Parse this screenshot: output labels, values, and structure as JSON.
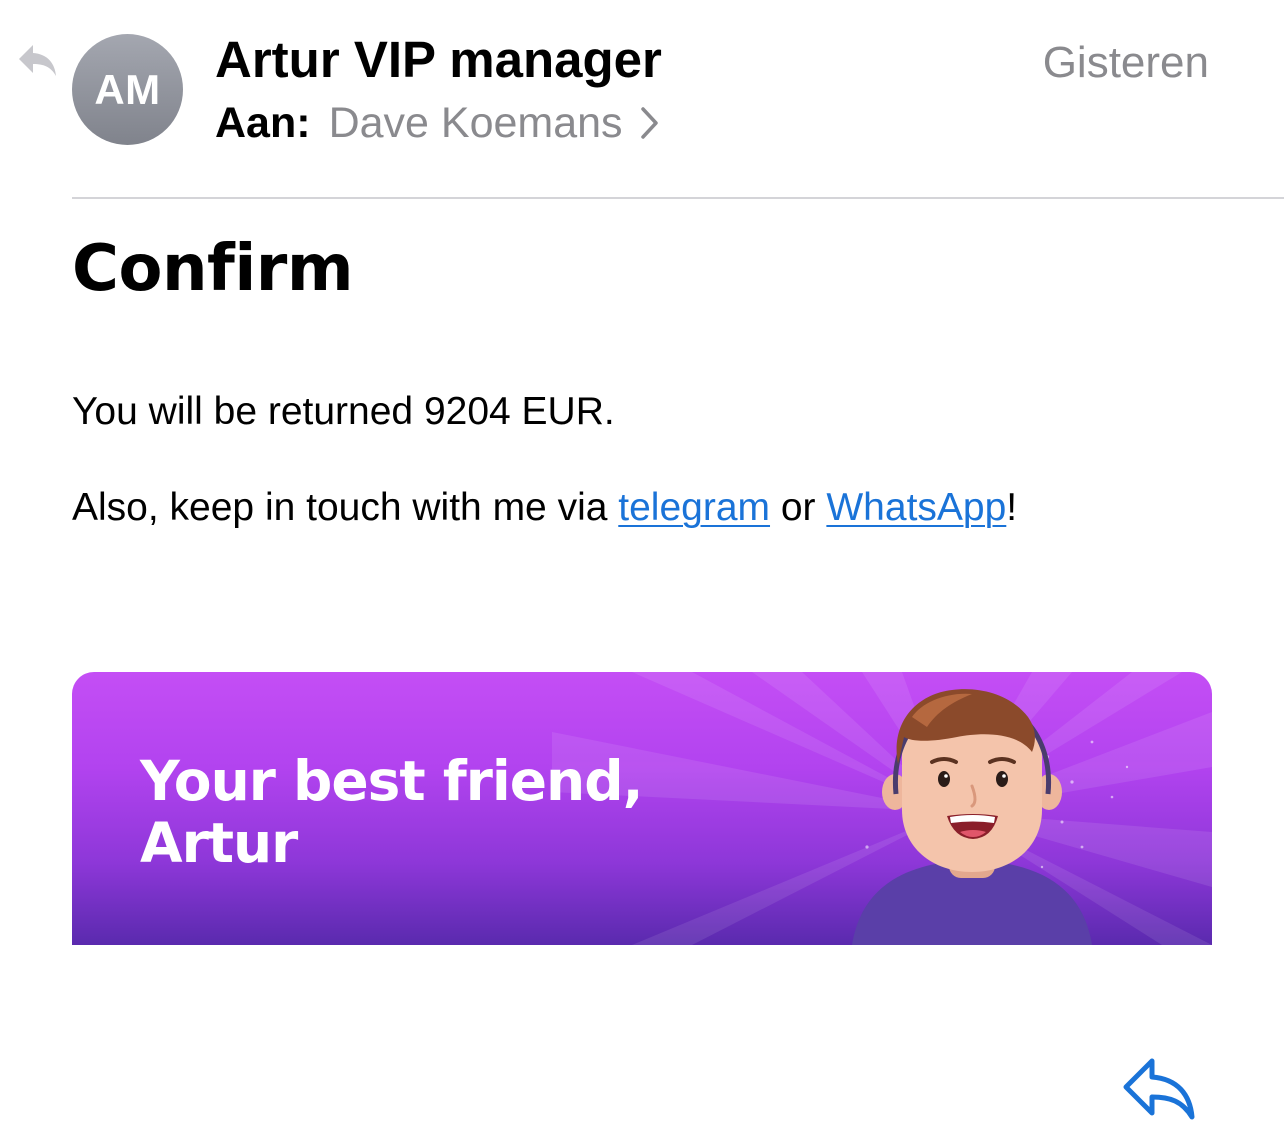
{
  "header": {
    "avatar_initials": "AM",
    "sender": "Artur VIP manager",
    "date": "Gisteren",
    "to_label": "Aan:",
    "recipient": "Dave Koemans"
  },
  "message": {
    "title": "Confirm",
    "line1": "You will be returned 9204 EUR.",
    "line2_prefix": "Also, keep in touch with me via ",
    "link_telegram": "telegram",
    "line2_middle": " or ",
    "link_whatsapp": "WhatsApp",
    "line2_suffix": "!"
  },
  "banner": {
    "line1": "Your best friend,",
    "line2": "Artur"
  },
  "colors": {
    "link": "#1a73d8",
    "secondary_text": "#8a8a8e",
    "banner_purple": "#b243ef",
    "reply_blue": "#1a73d8"
  },
  "icons": {
    "replied": "replied-arrow-icon",
    "chevron": "chevron-right-icon",
    "reply": "reply-arrow-icon"
  }
}
